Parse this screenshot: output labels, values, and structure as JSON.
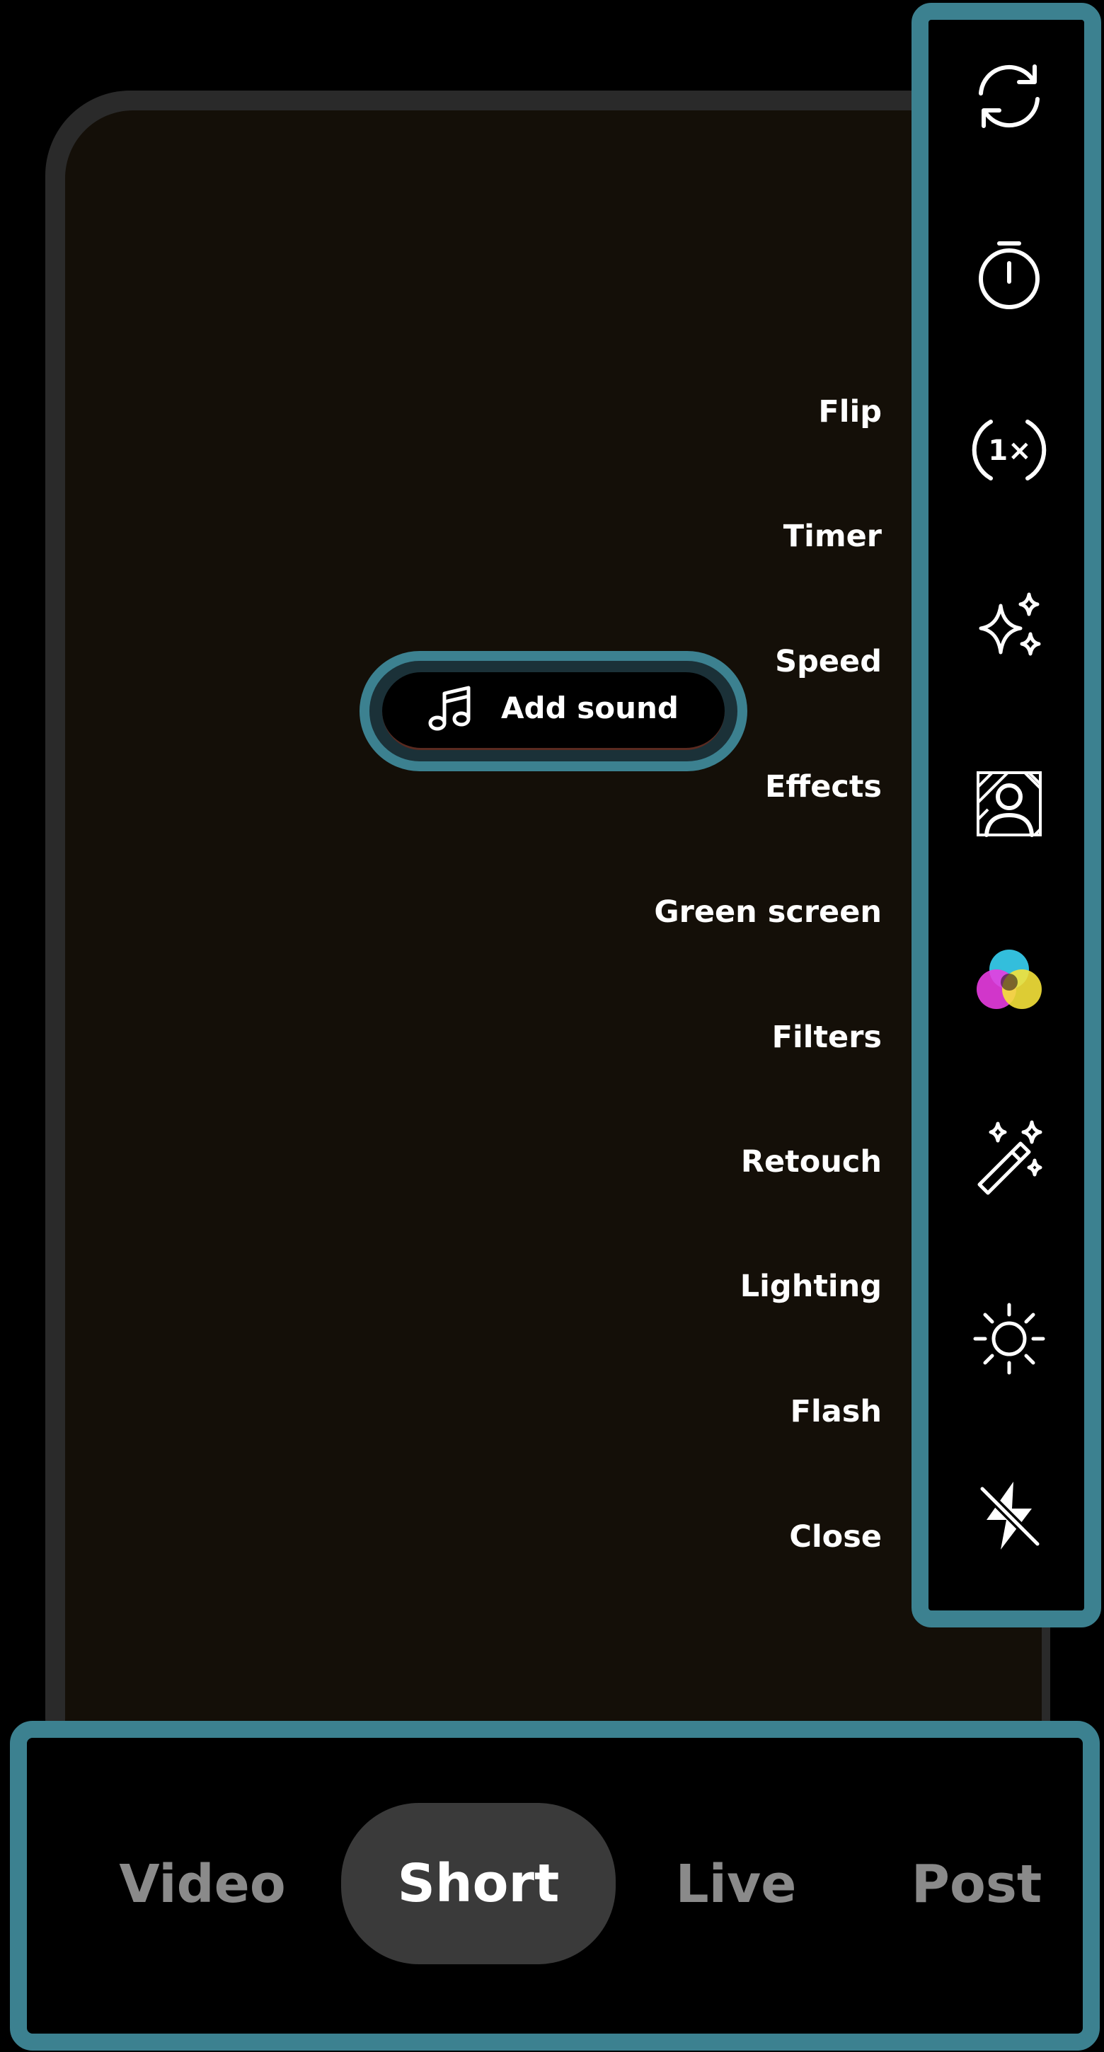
{
  "preview": {
    "labels": [
      {
        "key": "flip",
        "text": "Flip"
      },
      {
        "key": "timer",
        "text": "Timer"
      },
      {
        "key": "speed",
        "text": "Speed"
      },
      {
        "key": "effects",
        "text": "Effects"
      },
      {
        "key": "green-screen",
        "text": "Green screen"
      },
      {
        "key": "filters",
        "text": "Filters"
      },
      {
        "key": "retouch",
        "text": "Retouch"
      },
      {
        "key": "lighting",
        "text": "Lighting"
      },
      {
        "key": "flash",
        "text": "Flash"
      },
      {
        "key": "close",
        "text": "Close"
      }
    ],
    "add_sound": {
      "label": "Add sound",
      "icon": "music-note-icon"
    }
  },
  "toolbar": {
    "items": [
      {
        "name": "flip",
        "icon": "camera-flip-icon"
      },
      {
        "name": "timer",
        "icon": "stopwatch-icon"
      },
      {
        "name": "speed",
        "icon": "speed-icon",
        "value": "1×"
      },
      {
        "name": "effects",
        "icon": "sparkles-icon"
      },
      {
        "name": "green-screen",
        "icon": "green-screen-icon"
      },
      {
        "name": "filters",
        "icon": "color-filters-icon"
      },
      {
        "name": "retouch",
        "icon": "magic-wand-icon"
      },
      {
        "name": "lighting",
        "icon": "sun-icon"
      },
      {
        "name": "flash",
        "icon": "flash-off-icon"
      }
    ]
  },
  "modes": {
    "items": [
      "Video",
      "Short",
      "Live",
      "Post"
    ],
    "selected": "Short"
  },
  "colors": {
    "highlight": "#3c8190",
    "preview_bg": "#140f08",
    "active_pill": "#3a3a3a",
    "inactive_mode_text": "#8a8a8a"
  }
}
